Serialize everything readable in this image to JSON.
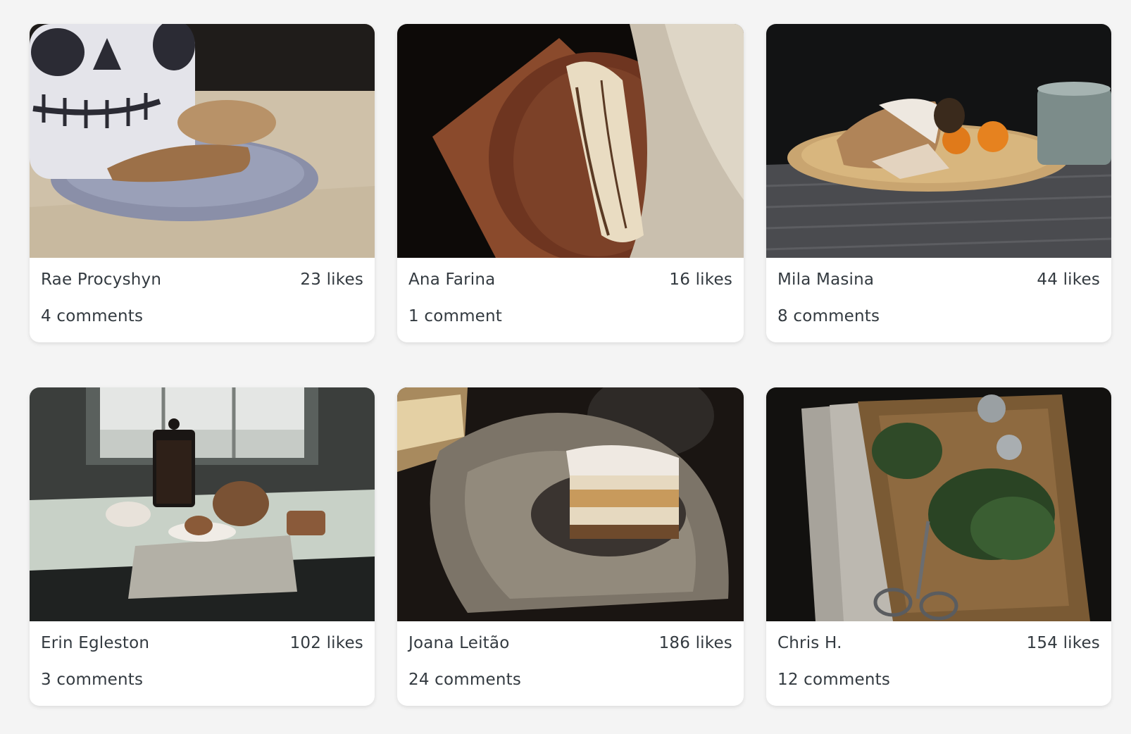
{
  "posts": [
    {
      "author": "Rae Procyshyn",
      "likes": "23 likes",
      "comments": "4 comments",
      "photo": "cookie-skull-mug-photo"
    },
    {
      "author": "Ana Farina",
      "likes": "16 likes",
      "comments": "1 comment",
      "photo": "bread-wooden-tray-photo"
    },
    {
      "author": "Mila Masina",
      "likes": "44 likes",
      "comments": "8 comments",
      "photo": "stollen-plate-mug-photo"
    },
    {
      "author": "Erin Egleston",
      "likes": "102 likes",
      "comments": "3 comments",
      "photo": "french-press-table-photo"
    },
    {
      "author": "Joana Leitão",
      "likes": "186 likes",
      "comments": "24 comments",
      "photo": "cream-cake-cloth-photo"
    },
    {
      "author": "Chris H.",
      "likes": "154 likes",
      "comments": "12 comments",
      "photo": "herbs-cutting-board-photo"
    }
  ],
  "colors": {
    "page_background": "#f4f4f4",
    "card_background": "#ffffff",
    "text": "#333a40"
  }
}
